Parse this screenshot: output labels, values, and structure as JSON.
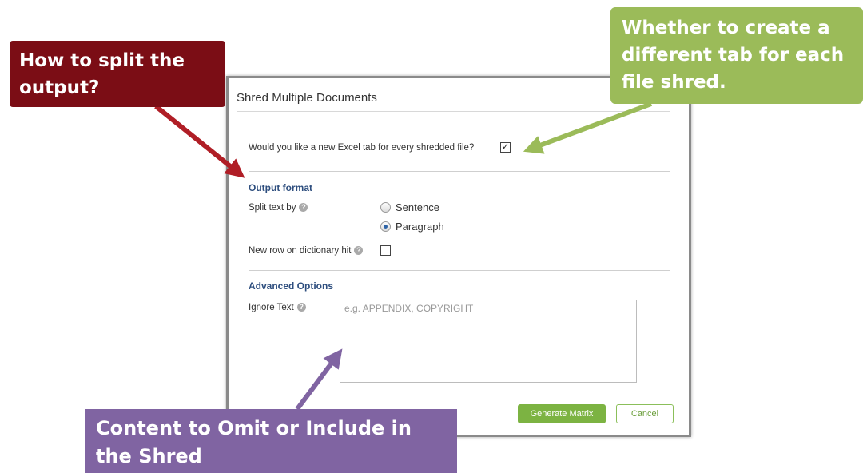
{
  "dialog": {
    "title": "Shred Multiple Documents",
    "new_tab_question": "Would you like a new Excel tab for every shredded file?",
    "new_tab_checked": true,
    "output_format": {
      "heading": "Output format",
      "split_label": "Split text by",
      "options": [
        {
          "label": "Sentence",
          "selected": false
        },
        {
          "label": "Paragraph",
          "selected": true
        }
      ],
      "new_row_label": "New row on dictionary hit",
      "new_row_checked": false
    },
    "advanced": {
      "heading": "Advanced Options",
      "ignore_label": "Ignore Text",
      "ignore_placeholder": "e.g. APPENDIX, COPYRIGHT"
    },
    "buttons": {
      "generate": "Generate Matrix",
      "cancel": "Cancel"
    }
  },
  "callouts": {
    "split": "How to split the output?",
    "tab": "Whether to create a different tab for each file shred.",
    "content": "Content to Omit or Include in the Shred"
  },
  "colors": {
    "red": "#7b0d15",
    "green": "#9bbb59",
    "purple": "#8064a2",
    "button_green": "#7cb342"
  }
}
